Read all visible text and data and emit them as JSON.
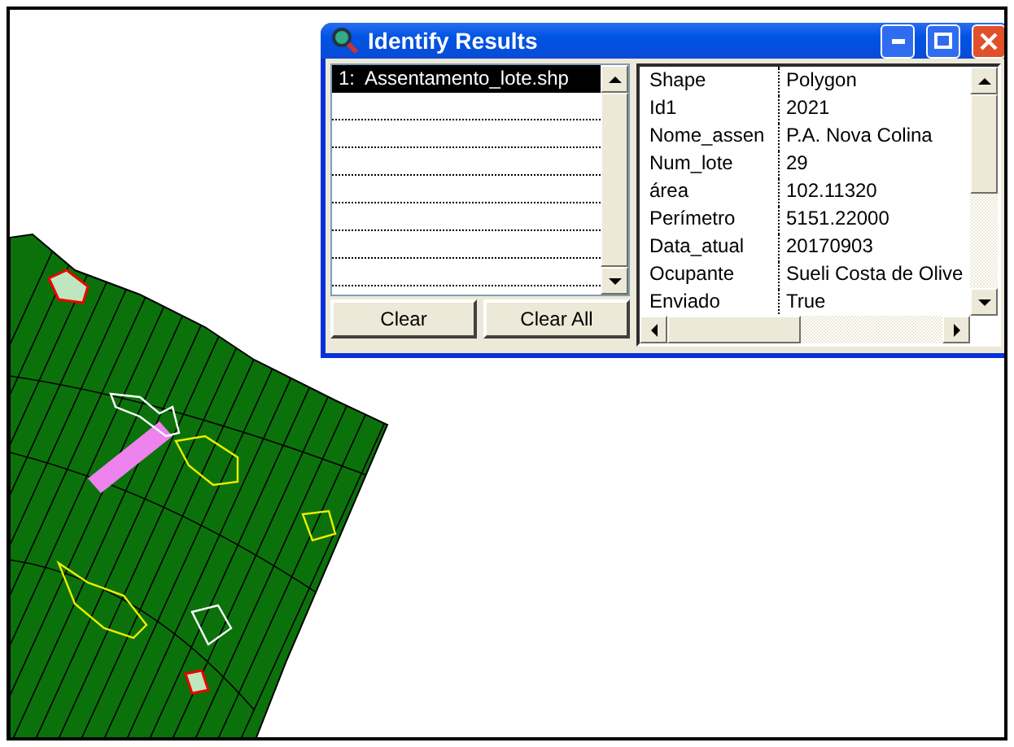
{
  "window": {
    "title": "Identify Results"
  },
  "layers": [
    {
      "label": "1:  Assentamento_lote.shp",
      "selected": true
    }
  ],
  "buttons": [
    "Clear",
    "Clear All"
  ],
  "attributes": [
    {
      "field": "Shape",
      "value": "Polygon"
    },
    {
      "field": "Id1",
      "value": "2021"
    },
    {
      "field": "Nome_assen",
      "value": "P.A. Nova Colina"
    },
    {
      "field": "Num_lote",
      "value": "29"
    },
    {
      "field": "área",
      "value": "102.11320"
    },
    {
      "field": "Perímetro",
      "value": "5151.22000"
    },
    {
      "field": "Data_atual",
      "value": "20170903"
    },
    {
      "field": "Ocupante",
      "value": "Sueli Costa de Olive"
    },
    {
      "field": "Enviado",
      "value": "True"
    }
  ]
}
